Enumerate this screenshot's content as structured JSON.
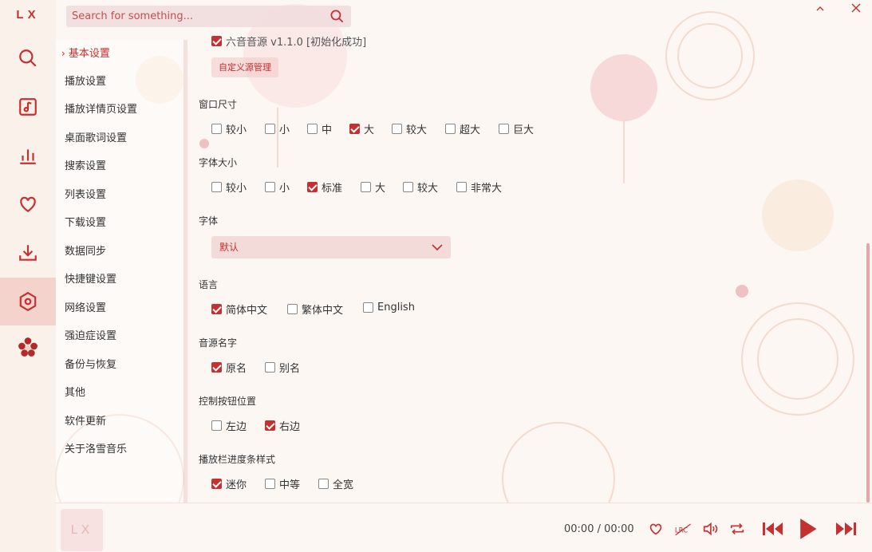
{
  "app": {
    "logo": "LX"
  },
  "search": {
    "placeholder": "Search for something..."
  },
  "nav": {
    "items": [
      {
        "label": "基本设置"
      },
      {
        "label": "播放设置"
      },
      {
        "label": "播放详情页设置"
      },
      {
        "label": "桌面歌词设置"
      },
      {
        "label": "搜索设置"
      },
      {
        "label": "列表设置"
      },
      {
        "label": "下载设置"
      },
      {
        "label": "数据同步"
      },
      {
        "label": "快捷键设置"
      },
      {
        "label": "网络设置"
      },
      {
        "label": "强迫症设置"
      },
      {
        "label": "备份与恢复"
      },
      {
        "label": "其他"
      },
      {
        "label": "软件更新"
      },
      {
        "label": "关于洛雪音乐"
      }
    ]
  },
  "settings": {
    "source": {
      "label": "六音音源 v1.1.0 [初始化成功]",
      "checked": true,
      "manage_button": "自定义源管理"
    },
    "window_size": {
      "title": "窗口尺寸",
      "options": [
        {
          "label": "较小",
          "checked": false
        },
        {
          "label": "小",
          "checked": false
        },
        {
          "label": "中",
          "checked": false
        },
        {
          "label": "大",
          "checked": true
        },
        {
          "label": "较大",
          "checked": false
        },
        {
          "label": "超大",
          "checked": false
        },
        {
          "label": "巨大",
          "checked": false
        }
      ]
    },
    "font_size": {
      "title": "字体大小",
      "options": [
        {
          "label": "较小",
          "checked": false
        },
        {
          "label": "小",
          "checked": false
        },
        {
          "label": "标准",
          "checked": true
        },
        {
          "label": "大",
          "checked": false
        },
        {
          "label": "较大",
          "checked": false
        },
        {
          "label": "非常大",
          "checked": false
        }
      ]
    },
    "font": {
      "title": "字体",
      "value": "默认"
    },
    "language": {
      "title": "语言",
      "options": [
        {
          "label": "简体中文",
          "checked": true
        },
        {
          "label": "繁体中文",
          "checked": false
        },
        {
          "label": "English",
          "checked": false
        }
      ]
    },
    "source_name": {
      "title": "音源名字",
      "options": [
        {
          "label": "原名",
          "checked": true
        },
        {
          "label": "别名",
          "checked": false
        }
      ]
    },
    "control_position": {
      "title": "控制按钮位置",
      "options": [
        {
          "label": "左边",
          "checked": false
        },
        {
          "label": "右边",
          "checked": true
        }
      ]
    },
    "progress_style": {
      "title": "播放栏进度条样式",
      "options": [
        {
          "label": "迷你",
          "checked": true
        },
        {
          "label": "中等",
          "checked": false
        },
        {
          "label": "全宽",
          "checked": false
        }
      ]
    }
  },
  "player": {
    "cover_text": "LX",
    "time_current": "00:00",
    "time_separator": "/",
    "time_total": "00:00",
    "lrc_label": "LRC"
  },
  "colors": {
    "accent": "#c53030"
  }
}
